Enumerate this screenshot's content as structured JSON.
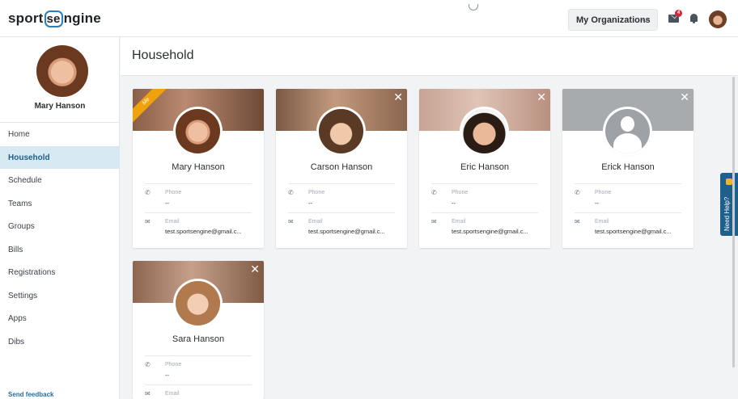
{
  "header": {
    "logo_left": "sport",
    "logo_mid": "se",
    "logo_right": "ngine",
    "orgs_button": "My Organizations",
    "mail_badge": "4"
  },
  "sidebar": {
    "profile_name": "Mary Hanson",
    "items": [
      {
        "label": "Home"
      },
      {
        "label": "Household"
      },
      {
        "label": "Schedule"
      },
      {
        "label": "Teams"
      },
      {
        "label": "Groups"
      },
      {
        "label": "Bills"
      },
      {
        "label": "Registrations"
      },
      {
        "label": "Settings"
      },
      {
        "label": "Apps"
      },
      {
        "label": "Dibs"
      }
    ],
    "active_item": "Household",
    "send_feedback": "Send feedback"
  },
  "page": {
    "title": "Household"
  },
  "cards": [
    {
      "name": "Mary Hanson",
      "ribbon": "Me",
      "phone_label": "Phone",
      "phone": "--",
      "email_label": "Email",
      "email": "test.sportsengine@gmail.c..."
    },
    {
      "name": "Carson Hanson",
      "phone_label": "Phone",
      "phone": "--",
      "email_label": "Email",
      "email": "test.sportsengine@gmail.c..."
    },
    {
      "name": "Eric Hanson",
      "phone_label": "Phone",
      "phone": "--",
      "email_label": "Email",
      "email": "test.sportsengine@gmail.c..."
    },
    {
      "name": "Erick Hanson",
      "phone_label": "Phone",
      "phone": "--",
      "email_label": "Email",
      "email": "test.sportsengine@gmail.c..."
    },
    {
      "name": "Sara Hanson",
      "phone_label": "Phone",
      "phone": "--",
      "email_label": "Email",
      "email": ""
    }
  ],
  "help_tab": "Need Help?",
  "colors": {
    "accent": "#1f5f8b",
    "active_nav_bg": "#d7e9f3",
    "ribbon": "#f0a20b",
    "badge": "#d2273a"
  }
}
